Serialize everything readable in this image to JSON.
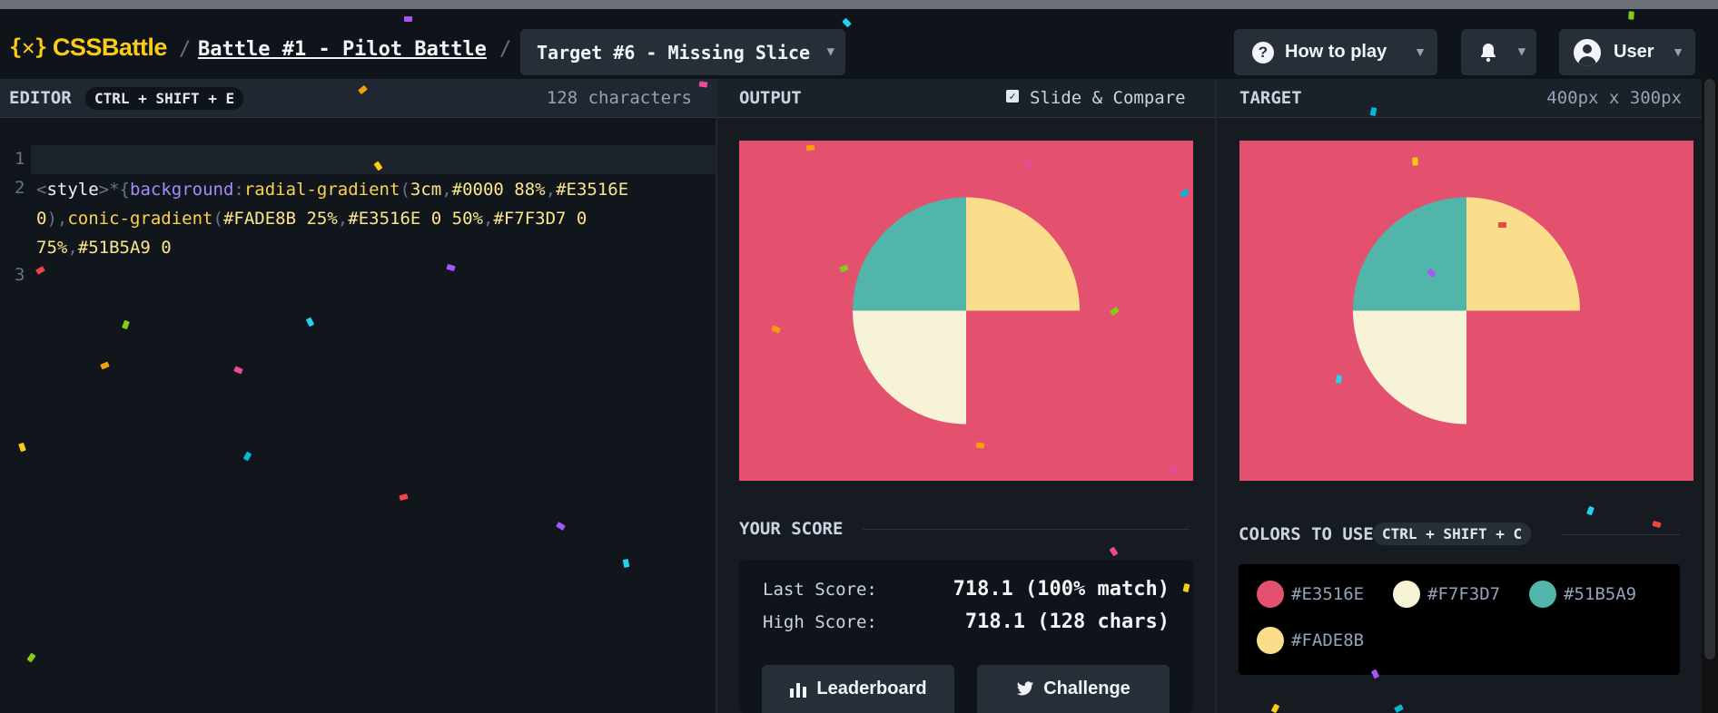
{
  "header": {
    "logo_mark": "{✕}",
    "logo_text": "CSSBattle",
    "separator": "/",
    "battle_link": "Battle #1 - Pilot Battle",
    "target_dropdown": "Target #6 - Missing Slice",
    "how_to_play": "How to play",
    "user": "User"
  },
  "editor": {
    "label": "EDITOR",
    "shortcut": "CTRL + SHIFT + E",
    "char_count": "128 characters",
    "line_numbers": [
      "1",
      "2",
      "3"
    ],
    "code_tokens": [
      {
        "text": "<",
        "cls": "c-br"
      },
      {
        "text": "style",
        "cls": "c-tag"
      },
      {
        "text": ">",
        "cls": "c-br"
      },
      {
        "text": "*{",
        "cls": "c-br"
      },
      {
        "text": "background",
        "cls": "c-prop"
      },
      {
        "text": ":",
        "cls": "c-br"
      },
      {
        "text": "radial-gradient",
        "cls": "c-fn"
      },
      {
        "text": "(",
        "cls": "c-br"
      },
      {
        "text": "3cm",
        "cls": "c-val"
      },
      {
        "text": ",",
        "cls": "c-br"
      },
      {
        "text": "#0000 88%",
        "cls": "c-val"
      },
      {
        "text": ",",
        "cls": "c-br"
      },
      {
        "text": "#E3516E 0",
        "cls": "c-val"
      },
      {
        "text": "),",
        "cls": "c-br"
      },
      {
        "text": "conic-gradient",
        "cls": "c-fn"
      },
      {
        "text": "(",
        "cls": "c-br"
      },
      {
        "text": "#FADE8B 25%",
        "cls": "c-val"
      },
      {
        "text": ",",
        "cls": "c-br"
      },
      {
        "text": "#E3516E 0 50%",
        "cls": "c-val"
      },
      {
        "text": ",",
        "cls": "c-br"
      },
      {
        "text": "#F7F3D7 0 75%",
        "cls": "c-val"
      },
      {
        "text": ",",
        "cls": "c-br"
      },
      {
        "text": "#51B5A9 0",
        "cls": "c-val"
      }
    ]
  },
  "output": {
    "label": "OUTPUT",
    "slide_compare": "Slide & Compare",
    "slide_compare_checked": true,
    "score_title": "YOUR SCORE",
    "last_score_label": "Last Score:",
    "last_score_value": "718.1 (100% match)",
    "high_score_label": "High Score:",
    "high_score_value": "718.1 (128 chars)",
    "leaderboard_button": "Leaderboard",
    "challenge_button": "Challenge"
  },
  "target": {
    "label": "TARGET",
    "dimensions": "400px x 300px",
    "colors_title": "COLORS TO USE",
    "colors_shortcut": "CTRL + SHIFT + C",
    "colors": [
      {
        "hex": "#E3516E",
        "label": "#E3516E"
      },
      {
        "hex": "#F7F3D7",
        "label": "#F7F3D7"
      },
      {
        "hex": "#51B5A9",
        "label": "#51B5A9"
      },
      {
        "hex": "#FADE8B",
        "label": "#FADE8B"
      }
    ]
  },
  "theme": {
    "accent": "#facc15",
    "canvas_bg": "#E3516E",
    "slice_teal": "#51B5A9",
    "slice_yellow": "#FADE8B",
    "slice_cream": "#F7F3D7"
  }
}
